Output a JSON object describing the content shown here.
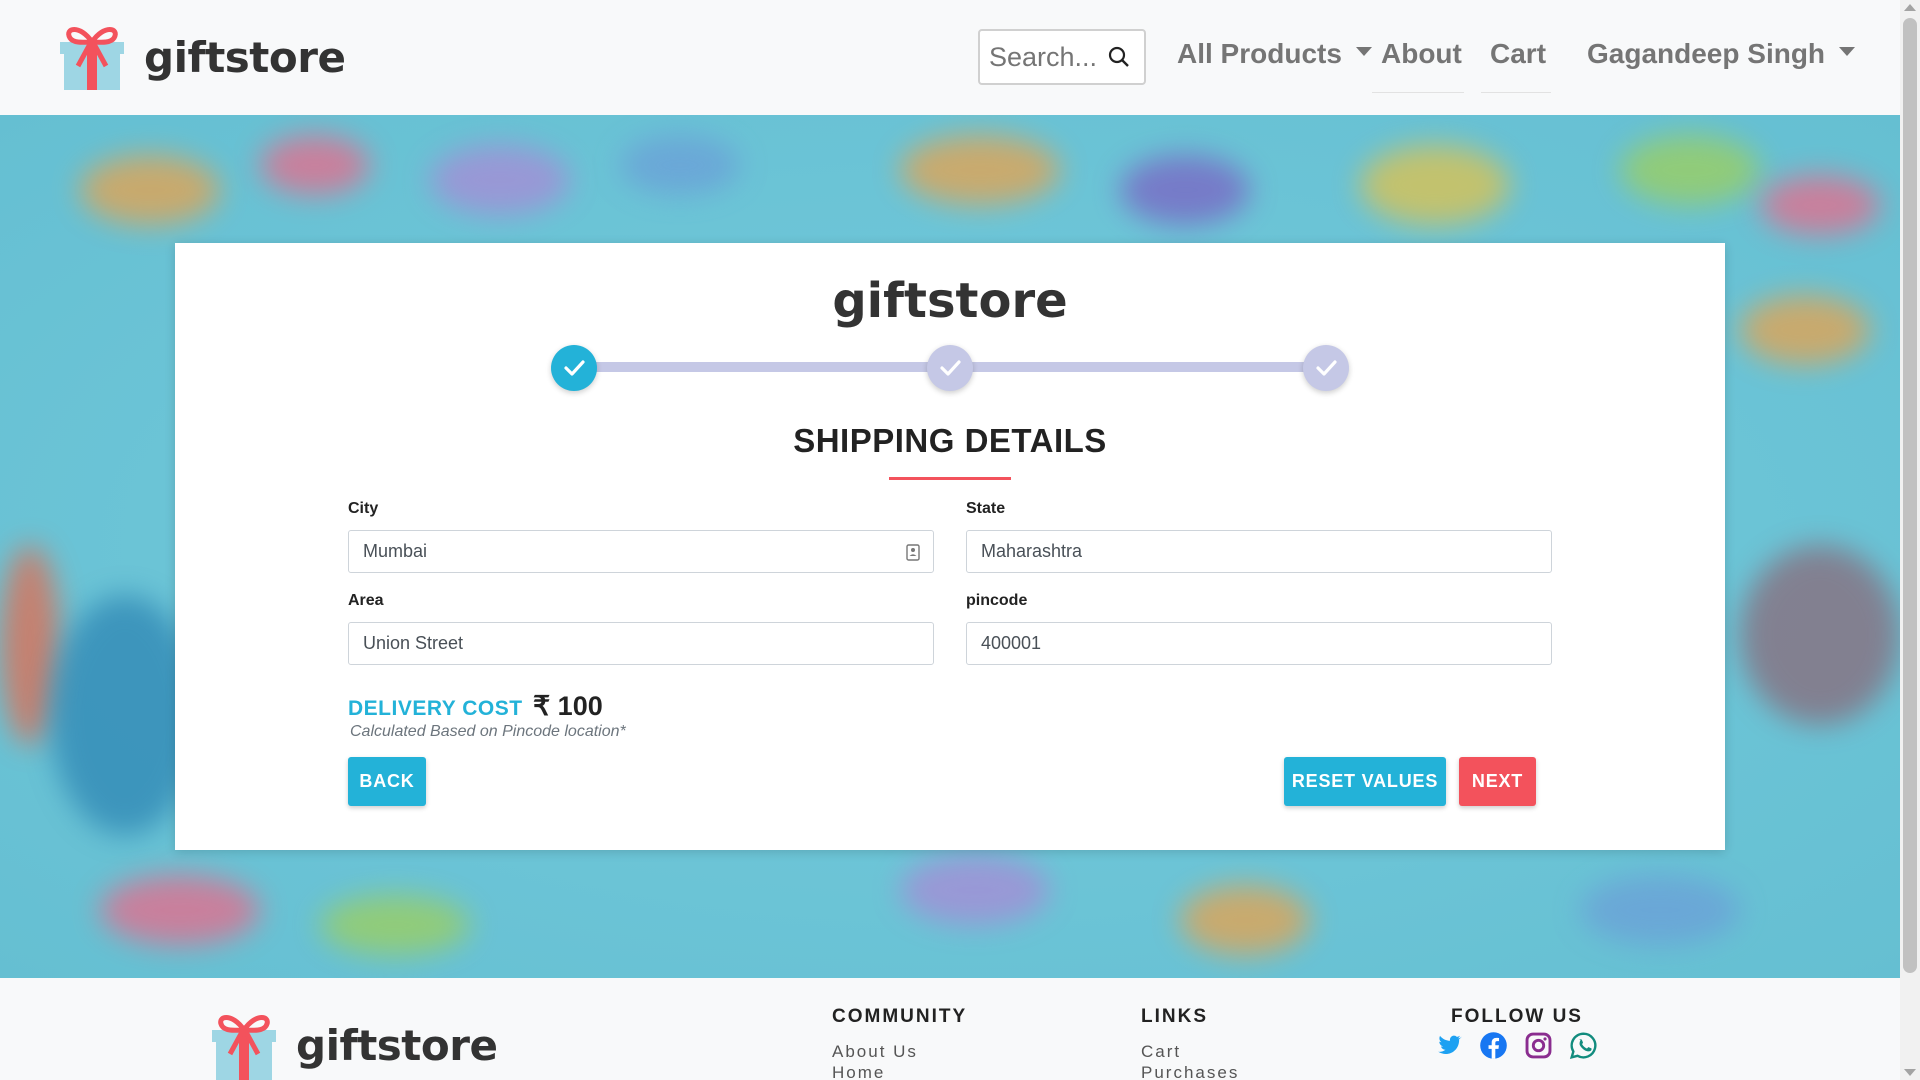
{
  "navbar": {
    "brand": "giftstore",
    "search_placeholder": "Search...",
    "all_products": "All Products",
    "about": "About",
    "cart": "Cart",
    "user": "Gagandeep Singh"
  },
  "card": {
    "brand": "giftstore",
    "steps": [
      "done",
      "pending",
      "pending"
    ],
    "section_title": "SHIPPING DETAILS",
    "fields": {
      "city": {
        "label": "City",
        "value": "Mumbai"
      },
      "state": {
        "label": "State",
        "value": "Maharashtra"
      },
      "area": {
        "label": "Area",
        "value": "Union Street"
      },
      "pincode": {
        "label": "pincode",
        "value": "400001"
      }
    },
    "delivery": {
      "label": "DELIVERY COST",
      "value": "₹ 100",
      "note": "Calculated Based on Pincode location*"
    },
    "buttons": {
      "back": "BACK",
      "reset": "RESET VALUES",
      "next": "NEXT"
    }
  },
  "footer": {
    "brand": "giftstore",
    "community": {
      "heading": "COMMUNITY",
      "links": [
        "About Us",
        "Home"
      ]
    },
    "links": {
      "heading": "LINKS",
      "links": [
        "Cart",
        "Purchases"
      ]
    },
    "follow": {
      "heading": "FOLLOW US",
      "icons": [
        "twitter-icon",
        "facebook-icon",
        "instagram-icon",
        "whatsapp-icon"
      ]
    }
  },
  "colors": {
    "accent_blue": "#23b2d8",
    "accent_red": "#f3525c",
    "step_pending": "#c5c8e6"
  }
}
